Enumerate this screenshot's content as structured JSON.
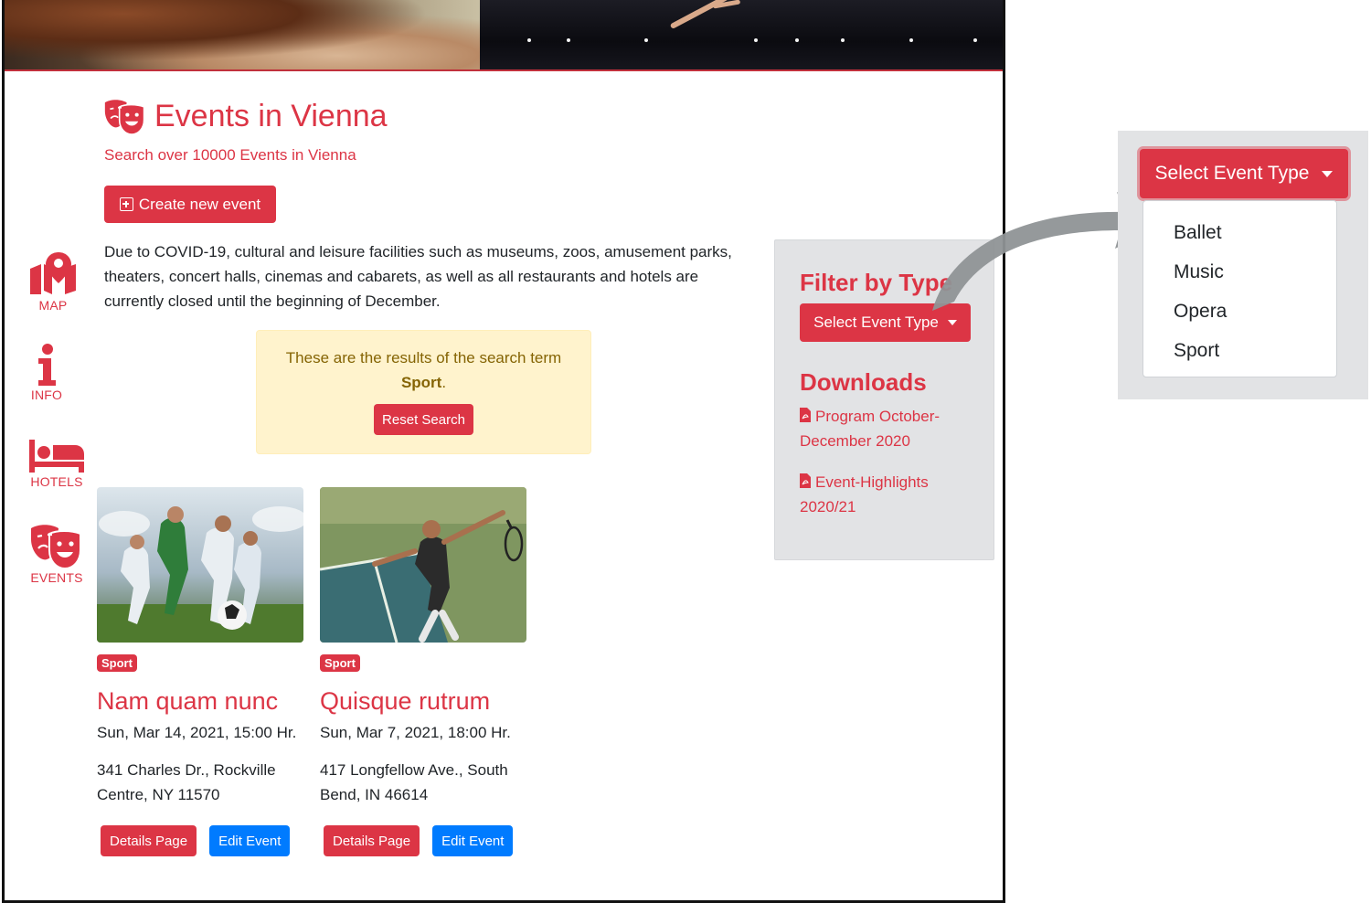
{
  "sidebar": {
    "items": [
      {
        "label": "MAP",
        "icon": "map-marker-icon"
      },
      {
        "label": "INFO",
        "icon": "info-icon"
      },
      {
        "label": "HOTELS",
        "icon": "bed-icon"
      },
      {
        "label": "EVENTS",
        "icon": "theater-masks-icon"
      }
    ]
  },
  "header": {
    "title": "Events in Vienna",
    "subtitle": "Search over 10000 Events in Vienna",
    "create_label": "Create new event"
  },
  "notice": "Due to COVID-19, cultural and leisure facilities such as museums, zoos, amusement parks, theaters, concert halls, cinemas and cabarets, as well as all restaurants and hotels are currently closed until the beginning of December.",
  "search_alert": {
    "text": "These are the results of the search term",
    "term": "Sport",
    "period": ".",
    "reset_label": "Reset Search"
  },
  "events": [
    {
      "badge": "Sport",
      "title": "Nam quam nunc",
      "date": "Sun, Mar 14, 2021, 15:00 Hr.",
      "address": "341 Charles Dr., Rockville Centre, NY 11570",
      "details_label": "Details Page",
      "edit_label": "Edit Event"
    },
    {
      "badge": "Sport",
      "title": "Quisque rutrum",
      "date": "Sun, Mar 7, 2021, 18:00 Hr.",
      "address": "417 Longfellow Ave., South Bend, IN 46614",
      "details_label": "Details Page",
      "edit_label": "Edit Event"
    }
  ],
  "filter": {
    "title": "Filter by Type",
    "button_label": "Select Event Type",
    "downloads_title": "Downloads",
    "downloads": [
      {
        "label": "Program October-December 2020"
      },
      {
        "label": "Event-Highlights 2020/21"
      }
    ]
  },
  "dropdown_zoom": {
    "button_label": "Select Event Type",
    "options": [
      "Ballet",
      "Music",
      "Opera",
      "Sport"
    ]
  },
  "colors": {
    "brand_red": "#dc3545",
    "primary_blue": "#007bff",
    "alert_bg": "#fff3cd",
    "panel_gray": "#e2e3e5"
  }
}
